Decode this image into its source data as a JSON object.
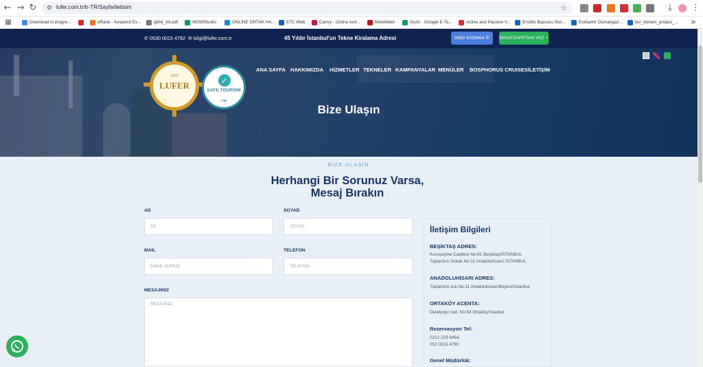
{
  "browser": {
    "url": "lufer.com.tr/tr-TR/Sayfa/iletisim",
    "nav": {
      "back": "←",
      "forward": "→",
      "reload": "↻",
      "site_info": "⚙",
      "star": "☆",
      "download": "⤓",
      "menu": "⋮"
    },
    "bookmarks": [
      {
        "label": "Download in progre...",
        "color": "#4285f4"
      },
      {
        "label": "",
        "color": "#e02424"
      },
      {
        "label": "eRank - Keyword Ex...",
        "color": "#e87722"
      },
      {
        "label": "gbhk_trk.pdf",
        "color": "#777777"
      },
      {
        "label": "WOWStudio",
        "color": "#0f9d58"
      },
      {
        "label": "ONLİNE ORTAK HA...",
        "color": "#0b8bd9"
      },
      {
        "label": "ETC Web",
        "color": "#1a5fb4"
      },
      {
        "label": "Canvy - Online tool...",
        "color": "#c2185b"
      },
      {
        "label": "Mütefekkir",
        "color": "#b71c1c"
      },
      {
        "label": "Gurlz - Google E-Ta...",
        "color": "#0f9d58"
      },
      {
        "label": "Active and Passive V...",
        "color": "#d32f2f"
      },
      {
        "label": "Enstitü Başvuru Sist...",
        "color": "#1565c0"
      },
      {
        "label": "Eskişehir Osmangaz...",
        "color": "#1565c0"
      },
      {
        "label": "tez_donem_projesi_...",
        "color": "#1565c0"
      }
    ],
    "more": "»"
  },
  "topbar": {
    "phone": "0530 0015 4782",
    "email": "bilgi@lufer.com.tr",
    "tagline": "45 Yıldır İstanbul'un Tekne Kiralama Adresi",
    "phone_button": "0850 4206464",
    "whatsapp_button": "WHATSAPPTAN YAZ"
  },
  "logos": {
    "brand": "LUFER",
    "year": "1979",
    "safe": "SAFE TOURISM",
    "safe_sub": "TSE"
  },
  "menu": [
    "ANA SAYFA",
    "HAKKIMIZDA",
    "HİZMETLER",
    "TEKNELER",
    "KAMPANYALAR",
    "MENÜLER",
    "BOSPHORUS CRUISES",
    "İLETİŞİM"
  ],
  "hero": {
    "title": "Bize Ulaşın"
  },
  "section": {
    "eyebrow": "BİZE ULAŞIN",
    "heading_line1": "Herhangi Bir Sorunuz Varsa,",
    "heading_line2": "Mesaj Bırakın"
  },
  "form": {
    "ad_label": "AD",
    "ad_placeholder": "AD",
    "soyad_label": "SOYAD",
    "soyad_placeholder": "SOYAD",
    "mail_label": "MAİL",
    "mail_placeholder": "EMAIL ADRESİ",
    "telefon_label": "TELEFON",
    "telefon_placeholder": "TELEFON",
    "mesaj_label": "MESAJINIZ",
    "mesaj_placeholder": "MESAJINIZ"
  },
  "info": {
    "title": "İletişim Bilgileri",
    "besiktas_h": "BEŞİKTAŞ ADRES:",
    "besiktas_1": "Kuruçeşme Caddesi No:61 Beşiktaş/İSTANBUL",
    "besiktas_2": "Toplarönü Sokak No:11 Anadoluhisarı/ İSTANBUL",
    "anadolu_h": "ANADOLUHİSARI ADRES:",
    "anadolu_1": "Toplarönü sok.No:11 Anadoluhisarı/Beykoz/İstanbul",
    "ortakoy_h": "ORTAKÖY ACENTA:",
    "ortakoy_1": "Dereboyu cad. No:94 Ortaköy/İstanbul",
    "rez_h": "Rezervasyon Tel:",
    "rez_1": "0212 229 6464",
    "rez_2": "053 0015 4782",
    "gm_h": "Genel Müdürlük:"
  }
}
